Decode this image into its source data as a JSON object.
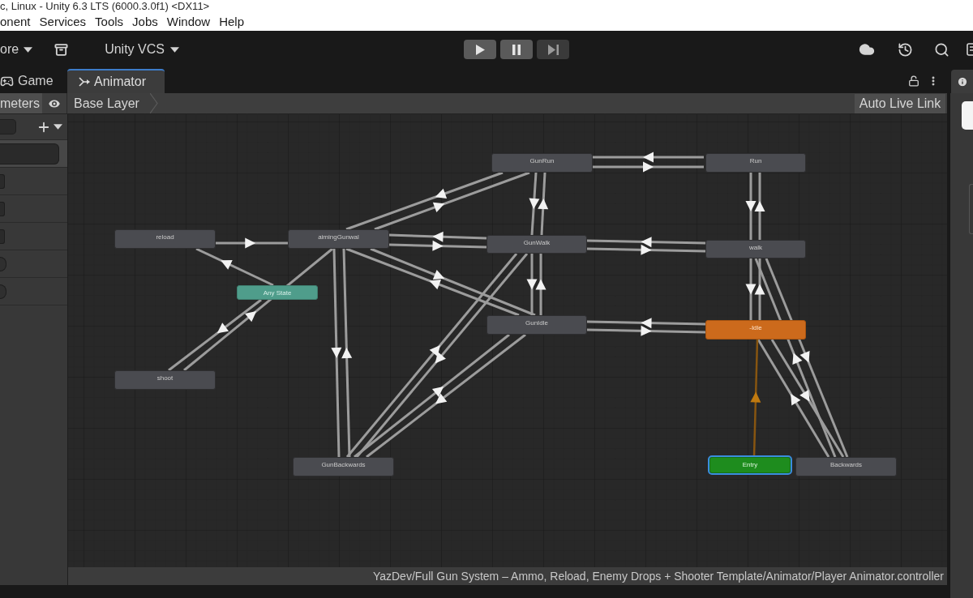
{
  "window": {
    "title": "c, Linux - Unity 6.3 LTS (6000.3.0f1) <DX11>"
  },
  "menu_bar": {
    "items": [
      "onent",
      "Services",
      "Tools",
      "Jobs",
      "Window",
      "Help"
    ]
  },
  "toolbar": {
    "account_menu": "ore",
    "vcs_menu": "Unity VCS",
    "play_controls": [
      {
        "kind": "play",
        "disabled": false
      },
      {
        "kind": "pause",
        "disabled": false
      },
      {
        "kind": "step",
        "disabled": true
      }
    ]
  },
  "tabs": [
    {
      "label": "Game",
      "kind": "game",
      "selected": false
    },
    {
      "label": "Animator",
      "kind": "animator",
      "selected": true
    }
  ],
  "animator": {
    "panel_tabs": [
      {
        "label": "meters",
        "selected": true
      }
    ],
    "breadcrumb": "Base Layer",
    "live_link_button": "Auto Live Link",
    "parameters": [
      {
        "kind": "text",
        "selected": true
      },
      {
        "kind": "number",
        "selected": false
      },
      {
        "kind": "number",
        "selected": false
      },
      {
        "kind": "number",
        "selected": false
      },
      {
        "kind": "trigger",
        "selected": false,
        "checked": false
      },
      {
        "kind": "trigger",
        "selected": false,
        "checked": false
      }
    ],
    "nodes": [
      {
        "label": "GunRun",
        "kind": "state",
        "selected": false
      },
      {
        "label": "Run",
        "kind": "state",
        "selected": false
      },
      {
        "label": "reload",
        "kind": "state",
        "selected": false
      },
      {
        "label": "aimingGunwal",
        "kind": "state",
        "selected": false
      },
      {
        "label": "GunWalk",
        "kind": "state",
        "selected": false
      },
      {
        "label": "walk",
        "kind": "state",
        "selected": false
      },
      {
        "label": "Any State",
        "kind": "any",
        "selected": false
      },
      {
        "label": "GunIdle",
        "kind": "state",
        "selected": false
      },
      {
        "label": "-Idle",
        "kind": "default",
        "selected": false
      },
      {
        "label": "shoot",
        "kind": "state",
        "selected": false
      },
      {
        "label": "GunBackwards",
        "kind": "state",
        "selected": false
      },
      {
        "label": "Entry",
        "kind": "entry",
        "selected": true
      },
      {
        "label": "Backwards",
        "kind": "state",
        "selected": false
      }
    ]
  },
  "status_bar": {
    "path": "YazDev/Full Gun System – Ammo, Reload, Enemy Drops + Shooter Template/Animator/Player Animator.controller"
  }
}
